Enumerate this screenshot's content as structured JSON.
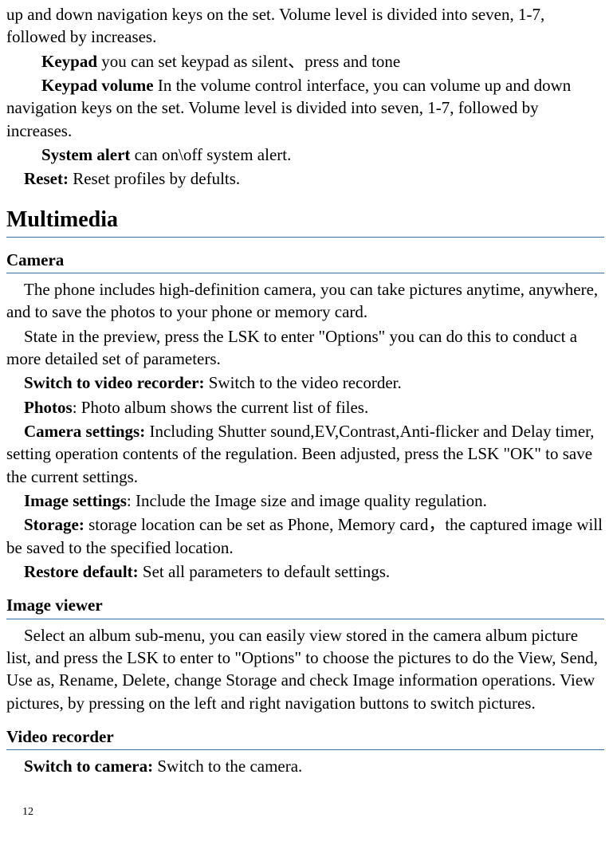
{
  "intro": {
    "line1": "up and down navigation keys on the set. Volume level is divided into seven, 1-7, followed by increases.",
    "keypad_label": "Keypad",
    "keypad_text": "      you can set keypad as silent、press and tone",
    "keypad_vol_label": "Keypad volume",
    "keypad_vol_text": "     In the volume control interface, you can volume up and down navigation keys on the set. Volume level is divided into seven, 1-7, followed by increases.",
    "sysalert_label": "System alert",
    "sysalert_text": "     can on\\off system alert.",
    "reset_label": "Reset:",
    "reset_text": "   Reset profiles by defults."
  },
  "multimedia": {
    "heading": "Multimedia",
    "camera": {
      "heading": "Camera",
      "p1": "The phone includes high-definition camera, you can take pictures anytime, anywhere, and to save the photos to your phone or memory card.",
      "p2": "State in the preview, press the LSK to enter \"Options\" you can do this to conduct a more detailed set of parameters.",
      "switch_label": "Switch to video recorder:",
      "switch_text": "   Switch to the video recorder.",
      "photos_label": "Photos",
      "photos_text": ":   Photo album shows the current list of files.",
      "camset_label": "Camera settings:",
      "camset_text": "   Including Shutter sound,EV,Contrast,Anti-flicker and Delay timer, setting operation contents of the regulation. Been adjusted, press the LSK \"OK\" to save the current settings.",
      "imgset_label": "Image settings",
      "imgset_text": ":   Include the Image size and image quality regulation.",
      "storage_label": "Storage:",
      "storage_text": "   storage location can be set as Phone, Memory card，the captured image will be saved to the specified location.",
      "restore_label": "Restore default:",
      "restore_text": "   Set all parameters to default settings."
    },
    "imageviewer": {
      "heading": "Image viewer",
      "p1": "Select an album sub-menu, you can easily view stored in the camera album picture list, and press the LSK to enter to \"Options\" to choose the pictures to do the View, Send, Use as, Rename, Delete, change Storage and check Image information operations. View pictures, by pressing on the left and right navigation buttons to switch pictures."
    },
    "videorecorder": {
      "heading": "Video recorder",
      "switch_label": "Switch to camera:",
      "switch_text": "   Switch to the camera."
    }
  },
  "pagenum": "12"
}
